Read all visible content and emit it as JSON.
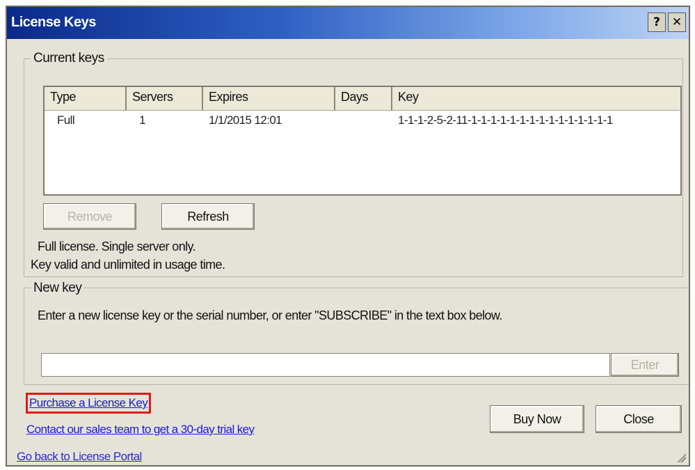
{
  "window": {
    "title": "License Keys",
    "help_glyph": "?",
    "close_glyph": "✕"
  },
  "current_keys": {
    "group_label": "Current keys",
    "columns": [
      "Type",
      "Servers",
      "Expires",
      "Days",
      "Key"
    ],
    "rows": [
      {
        "type": "Full",
        "servers": "1",
        "expires": "1/1/2015 12:01",
        "days": "",
        "key": "1-1-1-2-5-2-11-1-1-1-1-1-1-1-1-1-1-1-1-1-1-1"
      }
    ],
    "remove_button": "Remove",
    "refresh_button": "Refresh",
    "info_line1": "Full license. Single server only.",
    "info_line2": "Key valid and unlimited in usage time."
  },
  "new_key": {
    "group_label": "New key",
    "instruction": "Enter a new license key or the serial number, or enter \"SUBSCRIBE\" in the text box below.",
    "input_value": "",
    "input_placeholder": "",
    "enter_button": "Enter"
  },
  "links": {
    "purchase": "Purchase a License Key",
    "contact": "Contact our sales team to get a 30-day trial key",
    "go_back": "Go back to License Portal"
  },
  "footer": {
    "buy_now_button": "Buy Now",
    "close_button": "Close"
  },
  "colors": {
    "dialog_bg": "#e5e3d8",
    "title_gradient_start": "#0a2a8a",
    "link": "#1a1ad6",
    "highlight_box": "#e01a1a"
  }
}
